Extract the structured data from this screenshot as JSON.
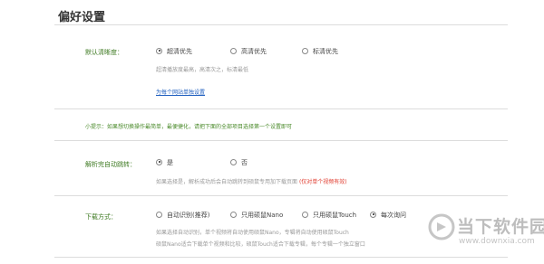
{
  "page": {
    "title": "偏好设置"
  },
  "resolution": {
    "label": "默认清晰度：",
    "options": [
      "超清优先",
      "高清优先",
      "标清优先"
    ],
    "selected": 0,
    "desc": "超清播放度最高，高清次之，标清最低",
    "link": "为每个网站单独设置"
  },
  "tip": "小提示：如果想切换操作最简单，最便捷化，请把下面的全部项目选择第一个设置即可",
  "autojump": {
    "label": "解析完自动跳转：",
    "options": [
      "是",
      "否"
    ],
    "selected": 0,
    "desc": "如果选择是，解析成功后会自动跳转到硕鼠专用加下载页面",
    "desc_red": "(仅对单个视频有效)"
  },
  "download": {
    "label": "下载方式：",
    "options": [
      "自动识别(推荐)",
      "只用硕鼠Nano",
      "只用硕鼠Touch",
      "每次询问"
    ],
    "selected": 3,
    "desc1": "如果选择自动识别，单个视频将自动使用硕鼠Nano，专辑将自动使用硕鼠Touch",
    "desc2": "硕鼠Nano适合下载单个视频和比较，硕鼠Touch适合下载专辑，每个专辑一个独立窗口"
  },
  "watermark": {
    "text": "当下软件园",
    "sub": "www.downxia.com"
  }
}
